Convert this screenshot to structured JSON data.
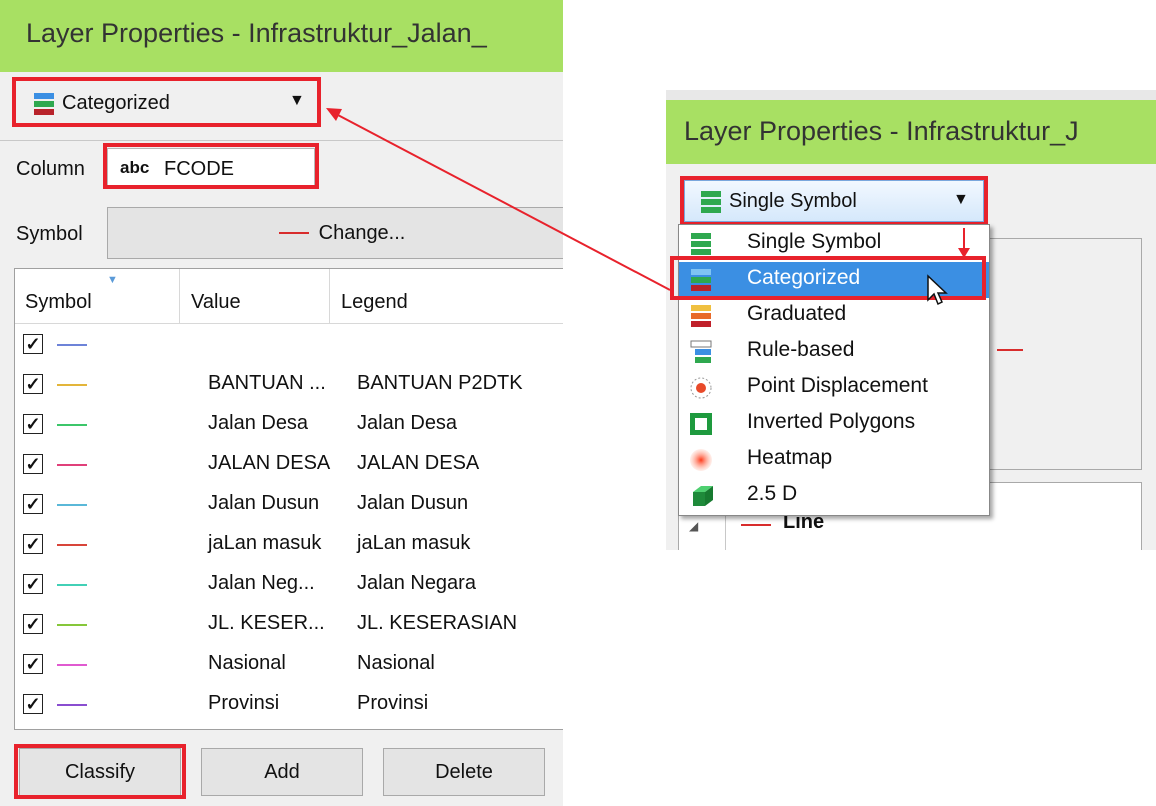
{
  "left_panel": {
    "title": "Layer Properties - Infrastruktur_Jalan_",
    "renderer_combo": "Categorized",
    "column_label": "Column",
    "column_type": "abc",
    "column_value": "FCODE",
    "symbol_label": "Symbol",
    "change_button": "Change...",
    "table": {
      "headers": [
        "Symbol",
        "Value",
        "Legend"
      ],
      "rows": [
        {
          "value": "",
          "legend": "",
          "color": "#6d83d8"
        },
        {
          "value": "BANTUAN ...",
          "legend": "BANTUAN P2DTK",
          "color": "#e3b53a"
        },
        {
          "value": "Jalan Desa",
          "legend": "Jalan Desa",
          "color": "#3cc66a"
        },
        {
          "value": "JALAN DESA",
          "legend": "JALAN DESA",
          "color": "#e0407a"
        },
        {
          "value": "Jalan Dusun",
          "legend": "Jalan Dusun",
          "color": "#5ab8d8"
        },
        {
          "value": "jaLan masuk",
          "legend": "jaLan masuk",
          "color": "#d8453a"
        },
        {
          "value": "Jalan Neg...",
          "legend": "Jalan Negara",
          "color": "#42d0b6"
        },
        {
          "value": "JL. KESER...",
          "legend": "JL. KESERASIAN",
          "color": "#86c73a"
        },
        {
          "value": "Nasional",
          "legend": "Nasional",
          "color": "#e05ad0"
        },
        {
          "value": "Provinsi",
          "legend": "Provinsi",
          "color": "#8a4ed0"
        }
      ]
    },
    "buttons": {
      "classify": "Classify",
      "add": "Add",
      "delete": "Delete"
    }
  },
  "right_panel": {
    "title": "Layer Properties - Infrastruktur_J",
    "renderer_combo": "Single Symbol",
    "menu_items": [
      {
        "label": "Single Symbol",
        "icon": "single-symbol-icon"
      },
      {
        "label": "Categorized",
        "icon": "categorized-icon",
        "selected": true
      },
      {
        "label": "Graduated",
        "icon": "graduated-icon"
      },
      {
        "label": "Rule-based",
        "icon": "rule-based-icon"
      },
      {
        "label": "Point Displacement",
        "icon": "point-displacement-icon"
      },
      {
        "label": "Inverted Polygons",
        "icon": "inverted-polygons-icon"
      },
      {
        "label": "Heatmap",
        "icon": "heatmap-icon"
      },
      {
        "label": "2.5 D",
        "icon": "2-5d-icon"
      }
    ],
    "symbol_tree_item": "Line"
  },
  "colors": {
    "highlight": "#e8222c",
    "title_bar": "#a8e063",
    "selection": "#3b8fe3"
  }
}
